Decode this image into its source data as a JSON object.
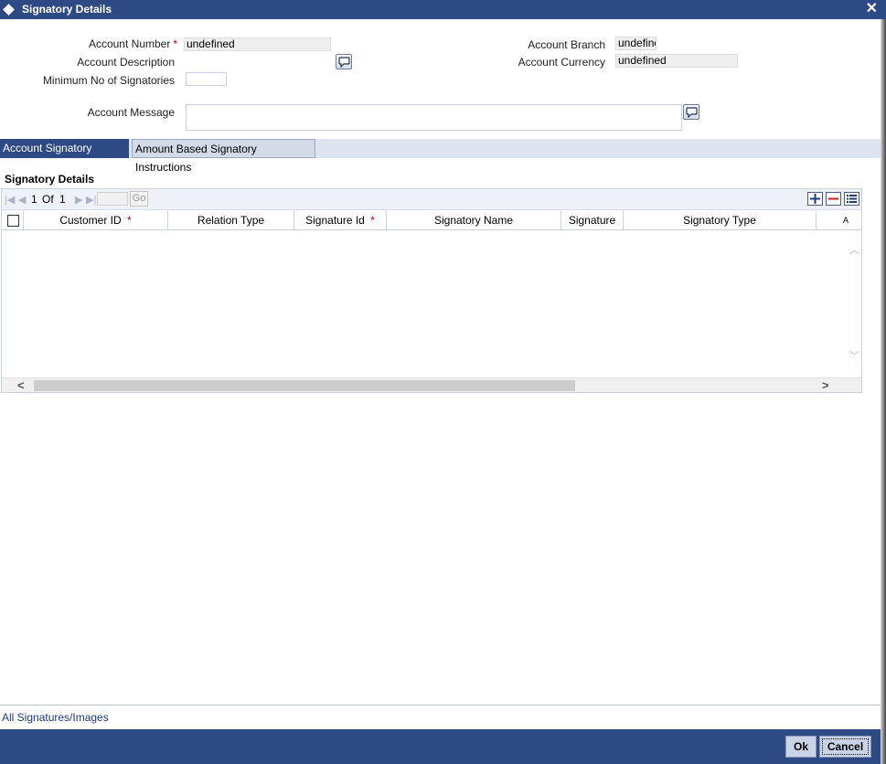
{
  "window": {
    "title": "Signatory Details"
  },
  "form": {
    "account_number_label": "Account Number",
    "account_number_value": "undefined",
    "account_description_label": "Account Description",
    "min_signatories_label": "Minimum No of Signatories",
    "account_message_label": "Account Message",
    "account_branch_label": "Account Branch",
    "account_branch_value": "undefine",
    "account_currency_label": "Account Currency",
    "account_currency_value": "undefined"
  },
  "tabs": [
    {
      "label": "Account Signatory Details"
    },
    {
      "label": "Amount Based Signatory Instructions"
    }
  ],
  "grid": {
    "section_title": "Signatory Details",
    "pager": {
      "current": "1",
      "of_label": "Of",
      "total": "1",
      "go_label": "Go"
    },
    "columns": [
      {
        "label": "Customer ID",
        "required": true
      },
      {
        "label": "Relation Type",
        "required": false
      },
      {
        "label": "Signature Id",
        "required": true
      },
      {
        "label": "Signatory Name",
        "required": false
      },
      {
        "label": "Signature",
        "required": false
      },
      {
        "label": "Signatory Type",
        "required": false
      },
      {
        "label": "A",
        "required": false
      }
    ],
    "rows": []
  },
  "footer": {
    "link_label": "All Signatures/Images",
    "ok_label": "Ok",
    "cancel_label": "Cancel"
  },
  "colors": {
    "titlebar": "#2e4a85",
    "required": "#cc0000",
    "link": "#1e3a8a"
  }
}
